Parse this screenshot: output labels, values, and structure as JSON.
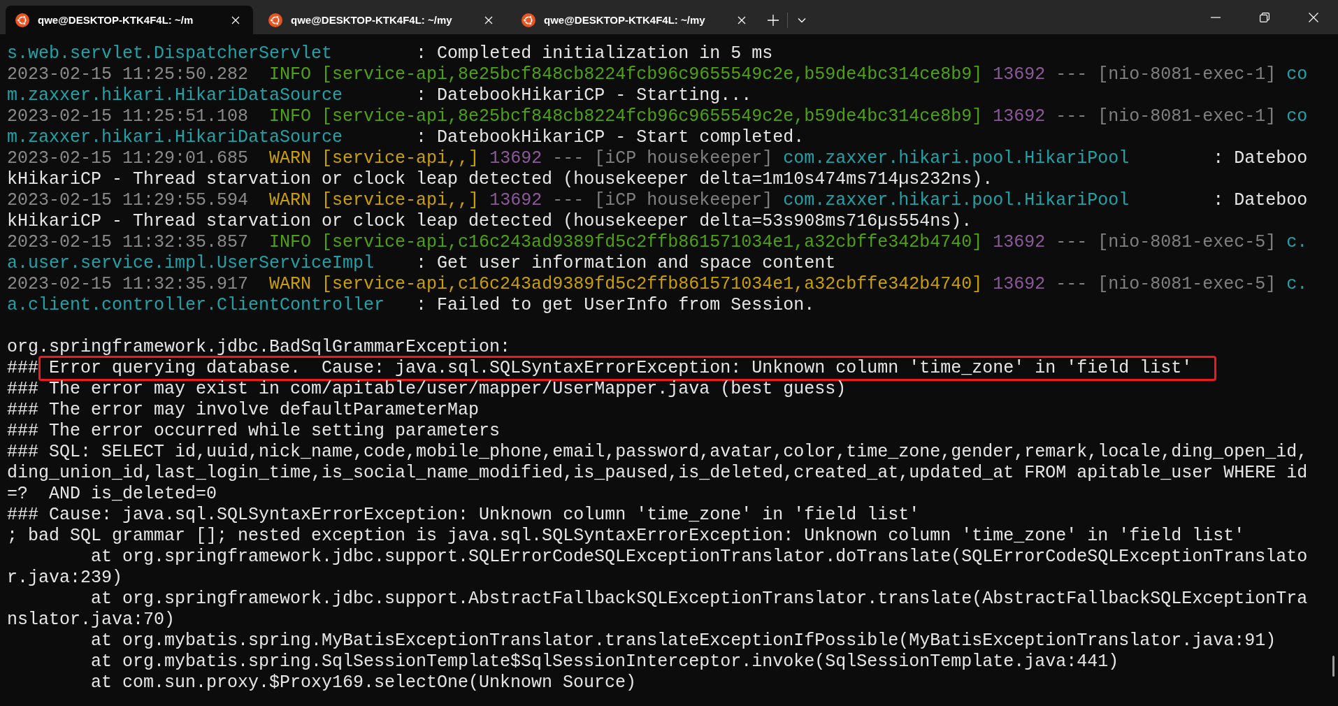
{
  "tabs": [
    {
      "title": "qwe@DESKTOP-KTK4F4L: ~/m",
      "selected": true
    },
    {
      "title": "qwe@DESKTOP-KTK4F4L: ~/my",
      "selected": false
    },
    {
      "title": "qwe@DESKTOP-KTK4F4L: ~/my",
      "selected": false
    }
  ],
  "lines": [
    {
      "kind": "text",
      "segments": [
        {
          "kind": "logger",
          "text": "s.web.servlet.DispatcherServlet        "
        },
        {
          "kind": "message",
          "text": ": Completed initialization in 5 ms"
        }
      ]
    },
    {
      "kind": "text",
      "segments": [
        {
          "kind": "timestamp",
          "text": "2023-02-15 11:25:50.282  "
        },
        {
          "kind": "info",
          "text": "INFO [service-api,8e25bcf848cb8224fcb96c9655549c2e,b59de4bc314ce8b9] "
        },
        {
          "kind": "pid",
          "text": "13692 "
        },
        {
          "kind": "thread",
          "text": "--- [nio-8081-exec-1] "
        },
        {
          "kind": "logger",
          "text": "co"
        }
      ]
    },
    {
      "kind": "text",
      "segments": [
        {
          "kind": "logger",
          "text": "m.zaxxer.hikari.HikariDataSource       "
        },
        {
          "kind": "message",
          "text": ": DatebookHikariCP - Starting..."
        }
      ]
    },
    {
      "kind": "text",
      "segments": [
        {
          "kind": "timestamp",
          "text": "2023-02-15 11:25:51.108  "
        },
        {
          "kind": "info",
          "text": "INFO [service-api,8e25bcf848cb8224fcb96c9655549c2e,b59de4bc314ce8b9] "
        },
        {
          "kind": "pid",
          "text": "13692 "
        },
        {
          "kind": "thread",
          "text": "--- [nio-8081-exec-1] "
        },
        {
          "kind": "logger",
          "text": "co"
        }
      ]
    },
    {
      "kind": "text",
      "segments": [
        {
          "kind": "logger",
          "text": "m.zaxxer.hikari.HikariDataSource       "
        },
        {
          "kind": "message",
          "text": ": DatebookHikariCP - Start completed."
        }
      ]
    },
    {
      "kind": "text",
      "segments": [
        {
          "kind": "timestamp",
          "text": "2023-02-15 11:29:01.685  "
        },
        {
          "kind": "warn",
          "text": "WARN [service-api,,] "
        },
        {
          "kind": "pid",
          "text": "13692 "
        },
        {
          "kind": "thread",
          "text": "--- [iCP housekeeper] "
        },
        {
          "kind": "logger",
          "text": "com.zaxxer.hikari.pool.HikariPool        "
        },
        {
          "kind": "message",
          "text": ": Dateboo"
        }
      ]
    },
    {
      "kind": "text",
      "segments": [
        {
          "kind": "message",
          "text": "kHikariCP - Thread starvation or clock leap detected (housekeeper delta=1m10s474ms714µs232ns)."
        }
      ]
    },
    {
      "kind": "text",
      "segments": [
        {
          "kind": "timestamp",
          "text": "2023-02-15 11:29:55.594  "
        },
        {
          "kind": "warn",
          "text": "WARN [service-api,,] "
        },
        {
          "kind": "pid",
          "text": "13692 "
        },
        {
          "kind": "thread",
          "text": "--- [iCP housekeeper] "
        },
        {
          "kind": "logger",
          "text": "com.zaxxer.hikari.pool.HikariPool        "
        },
        {
          "kind": "message",
          "text": ": Dateboo"
        }
      ]
    },
    {
      "kind": "text",
      "segments": [
        {
          "kind": "message",
          "text": "kHikariCP - Thread starvation or clock leap detected (housekeeper delta=53s908ms716µs554ns)."
        }
      ]
    },
    {
      "kind": "text",
      "segments": [
        {
          "kind": "timestamp",
          "text": "2023-02-15 11:32:35.857  "
        },
        {
          "kind": "info",
          "text": "INFO [service-api,c16c243ad9389fd5c2ffb861571034e1,a32cbffe342b4740] "
        },
        {
          "kind": "pid",
          "text": "13692 "
        },
        {
          "kind": "thread",
          "text": "--- [nio-8081-exec-5] "
        },
        {
          "kind": "logger",
          "text": "c."
        }
      ]
    },
    {
      "kind": "text",
      "segments": [
        {
          "kind": "logger",
          "text": "a.user.service.impl.UserServiceImpl    "
        },
        {
          "kind": "message",
          "text": ": Get user information and space content"
        }
      ]
    },
    {
      "kind": "text",
      "segments": [
        {
          "kind": "timestamp",
          "text": "2023-02-15 11:32:35.917  "
        },
        {
          "kind": "warn",
          "text": "WARN [service-api,c16c243ad9389fd5c2ffb861571034e1,a32cbffe342b4740] "
        },
        {
          "kind": "pid",
          "text": "13692 "
        },
        {
          "kind": "thread",
          "text": "--- [nio-8081-exec-5] "
        },
        {
          "kind": "logger",
          "text": "c."
        }
      ]
    },
    {
      "kind": "text",
      "segments": [
        {
          "kind": "logger",
          "text": "a.client.controller.ClientController   "
        },
        {
          "kind": "message",
          "text": ": Failed to get UserInfo from Session."
        }
      ]
    },
    {
      "kind": "blank"
    },
    {
      "kind": "text",
      "segments": [
        {
          "kind": "plain",
          "text": "org.springframework.jdbc.BadSqlGrammarException:"
        }
      ]
    },
    {
      "kind": "text",
      "segments": [
        {
          "kind": "plain",
          "text": "###"
        },
        {
          "kind": "highlight",
          "text": "Error querying database.  Cause: java.sql.SQLSyntaxErrorException: Unknown column 'time_zone' in 'field list'"
        }
      ]
    },
    {
      "kind": "text",
      "segments": [
        {
          "kind": "plain",
          "text": "### The error may exist in com/apitable/user/mapper/UserMapper.java (best guess)"
        }
      ]
    },
    {
      "kind": "text",
      "segments": [
        {
          "kind": "plain",
          "text": "### The error may involve defaultParameterMap"
        }
      ]
    },
    {
      "kind": "text",
      "segments": [
        {
          "kind": "plain",
          "text": "### The error occurred while setting parameters"
        }
      ]
    },
    {
      "kind": "text",
      "segments": [
        {
          "kind": "plain",
          "text": "### SQL: SELECT id,uuid,nick_name,code,mobile_phone,email,password,avatar,color,time_zone,gender,remark,locale,ding_open_id,"
        }
      ]
    },
    {
      "kind": "text",
      "segments": [
        {
          "kind": "plain",
          "text": "ding_union_id,last_login_time,is_social_name_modified,is_paused,is_deleted,created_at,updated_at FROM apitable_user WHERE id"
        }
      ]
    },
    {
      "kind": "text",
      "segments": [
        {
          "kind": "plain",
          "text": "=?  AND is_deleted=0"
        }
      ]
    },
    {
      "kind": "text",
      "segments": [
        {
          "kind": "plain",
          "text": "### Cause: java.sql.SQLSyntaxErrorException: Unknown column 'time_zone' in 'field list'"
        }
      ]
    },
    {
      "kind": "text",
      "segments": [
        {
          "kind": "plain",
          "text": "; bad SQL grammar []; nested exception is java.sql.SQLSyntaxErrorException: Unknown column 'time_zone' in 'field list'"
        }
      ]
    },
    {
      "kind": "text",
      "segments": [
        {
          "kind": "trace",
          "text": "at org.springframework.jdbc.support.SQLErrorCodeSQLExceptionTranslator.doTranslate(SQLErrorCodeSQLExceptionTranslato"
        }
      ]
    },
    {
      "kind": "text",
      "segments": [
        {
          "kind": "plain",
          "text": "r.java:239)"
        }
      ]
    },
    {
      "kind": "text",
      "segments": [
        {
          "kind": "trace",
          "text": "at org.springframework.jdbc.support.AbstractFallbackSQLExceptionTranslator.translate(AbstractFallbackSQLExceptionTra"
        }
      ]
    },
    {
      "kind": "text",
      "segments": [
        {
          "kind": "plain",
          "text": "nslator.java:70)"
        }
      ]
    },
    {
      "kind": "text",
      "segments": [
        {
          "kind": "trace",
          "text": "at org.mybatis.spring.MyBatisExceptionTranslator.translateExceptionIfPossible(MyBatisExceptionTranslator.java:91)"
        }
      ]
    },
    {
      "kind": "text",
      "segments": [
        {
          "kind": "trace",
          "text": "at org.mybatis.spring.SqlSessionTemplate$SqlSessionInterceptor.invoke(SqlSessionTemplate.java:441)"
        }
      ]
    },
    {
      "kind": "text",
      "segments": [
        {
          "kind": "trace",
          "text": "at com.sun.proxy.$Proxy169.selectOne(Unknown Source)"
        }
      ]
    }
  ]
}
